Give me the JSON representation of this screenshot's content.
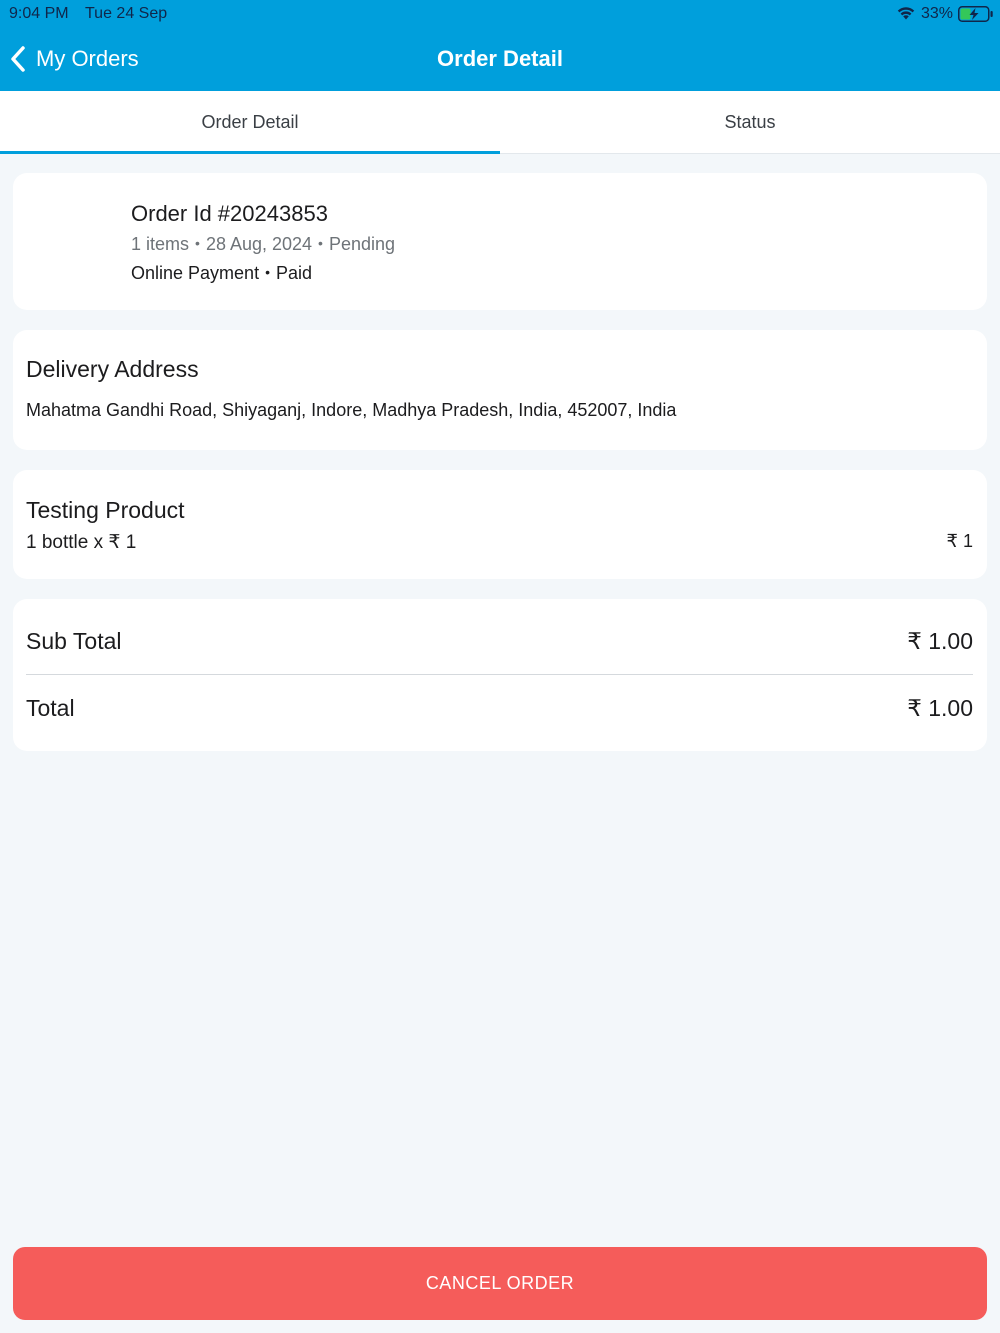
{
  "status_bar": {
    "time": "9:04 PM",
    "date": "Tue 24 Sep",
    "battery_percent": "33%",
    "icons": [
      "wifi-icon",
      "battery-charging-icon"
    ]
  },
  "nav": {
    "back_label": "My Orders",
    "title": "Order Detail",
    "color": "#009fdc"
  },
  "tabs": [
    {
      "label": "Order Detail",
      "active": true
    },
    {
      "label": "Status",
      "active": false
    }
  ],
  "order": {
    "id_text": "Order Id #20243853",
    "items": "1 items",
    "date": "28 Aug, 2024",
    "status": "Pending",
    "payment_method": "Online Payment",
    "payment_status": "Paid",
    "separator": "•"
  },
  "delivery": {
    "heading": "Delivery Address",
    "address": "Mahatma Gandhi Road, Shiyaganj, Indore, Madhya Pradesh, India, 452007, India"
  },
  "products": [
    {
      "name": "Testing Product",
      "quantity_line": "1 bottle x ₹ 1",
      "price": "₹ 1"
    }
  ],
  "totals": {
    "subtotal_label": "Sub Total",
    "subtotal_value": "₹ 1.00",
    "total_label": "Total",
    "total_value": "₹ 1.00"
  },
  "actions": {
    "cancel_label": "CANCEL ORDER",
    "cancel_color": "#f55c5a"
  }
}
